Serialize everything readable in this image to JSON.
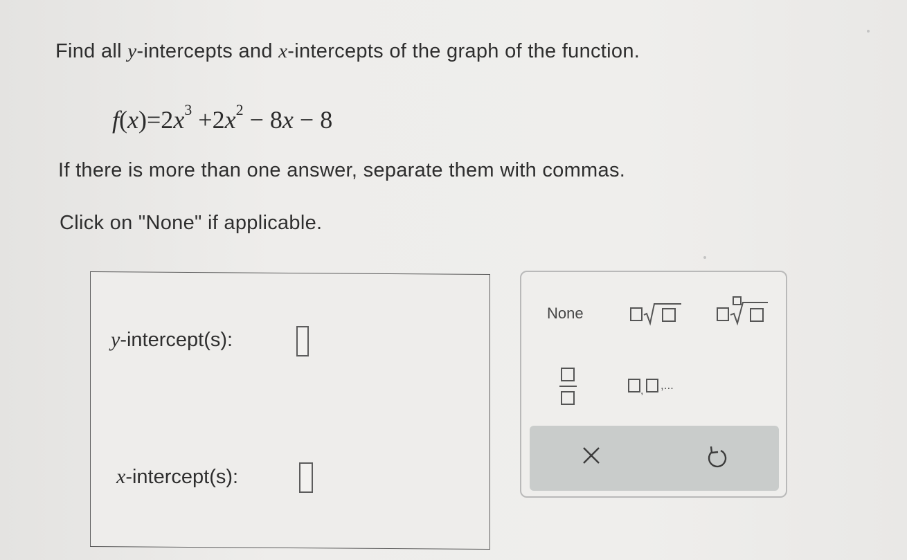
{
  "question": {
    "line1_pre": "Find all ",
    "line1_y": "y",
    "line1_mid": "-intercepts and ",
    "line1_x": "x",
    "line1_post": "-intercepts of the graph of the function.",
    "formula": {
      "f": "f",
      "x1": "x",
      "eq": "=2",
      "x2": "x",
      "exp1": "3",
      "plus2": " +2",
      "x3": "x",
      "exp2": "2",
      "rest_a": " − 8",
      "x4": "x",
      "rest_b": " − 8"
    },
    "line3": "If there is more than one answer, separate them with commas.",
    "line4": "Click on \"None\" if applicable."
  },
  "answers": {
    "y_var": "y",
    "y_label": "-intercept(s):",
    "x_var": "x",
    "x_label": "-intercept(s):"
  },
  "palette": {
    "none_label": "None",
    "list_ellipsis": ",...",
    "clear_glyph": "×",
    "undo_glyph": "↺"
  }
}
